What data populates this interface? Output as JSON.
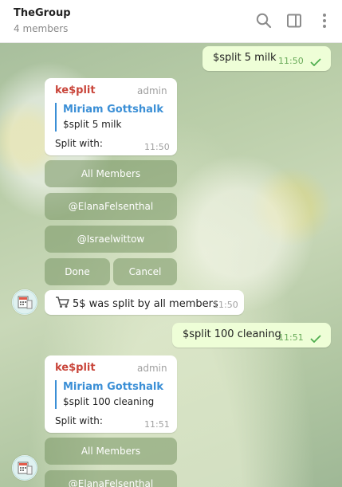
{
  "header": {
    "title": "TheGroup",
    "subtitle": "4 members",
    "icons": [
      "search-icon",
      "sidebar-toggle-icon",
      "more-vertical-icon"
    ]
  },
  "messages": {
    "m1": {
      "text": "$split 5 milk",
      "time": "11:50"
    },
    "m2": {
      "sender": "ke$plit",
      "role": "admin",
      "quote_name": "Miriam Gottshalk",
      "quote_text": "$split 5 milk",
      "body": "Split with:",
      "time": "11:50",
      "buttons": {
        "all": "All Members",
        "b1": "@ElanaFelsenthal",
        "b2": "@Israelwittow",
        "done": "Done",
        "cancel": "Cancel"
      }
    },
    "m3": {
      "text": "5$ was split by all members",
      "time": "11:50"
    },
    "m4": {
      "text": "$split 100 cleaning",
      "time": "11:51"
    },
    "m5": {
      "sender": "ke$plit",
      "role": "admin",
      "quote_name": "Miriam Gottshalk",
      "quote_text": "$split 100 cleaning",
      "body": "Split with:",
      "time": "11:51",
      "buttons": {
        "all": "All Members",
        "b1": "@ElanaFelsenthal"
      }
    }
  },
  "colors": {
    "sender": "#c9453a",
    "quote_accent": "#3b8fd6",
    "outgoing_bubble": "#eefed7",
    "read_check": "#4fae4e"
  }
}
